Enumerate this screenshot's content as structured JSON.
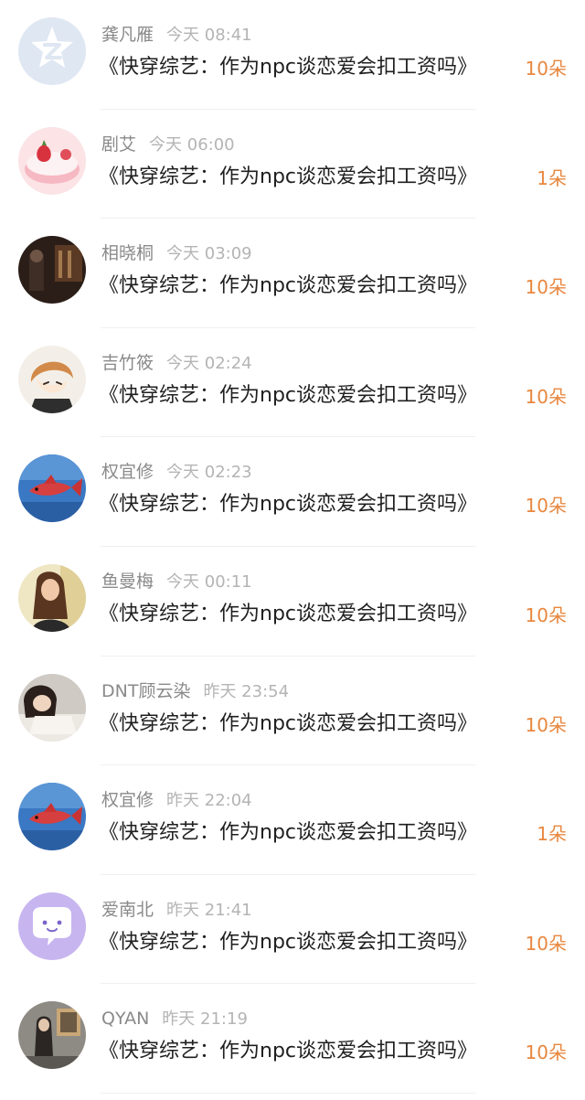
{
  "colors": {
    "name": "#8a8a8a",
    "time": "#b4b4b4",
    "title": "#1f1f1f",
    "flower_count": "#e8873f"
  },
  "items": [
    {
      "name": "龚凡雁",
      "time": "今天 08:41",
      "title": "《快穿综艺：作为npc谈恋爱会扣工资吗》",
      "count": "10朵",
      "avatar": "default-z-icon"
    },
    {
      "name": "剧艾",
      "time": "今天 06:00",
      "title": "《快穿综艺：作为npc谈恋爱会扣工资吗》",
      "count": "1朵",
      "avatar": "strawberry-cake-photo"
    },
    {
      "name": "相晓桐",
      "time": "今天 03:09",
      "title": "《快穿综艺：作为npc谈恋爱会扣工资吗》",
      "count": "10朵",
      "avatar": "dark-room-photo"
    },
    {
      "name": "吉竹筱",
      "time": "今天 02:24",
      "title": "《快穿综艺：作为npc谈恋爱会扣工资吗》",
      "count": "10朵",
      "avatar": "anime-character-illustration"
    },
    {
      "name": "权宜修",
      "time": "今天 02:23",
      "title": "《快穿综艺：作为npc谈恋爱会扣工资吗》",
      "count": "10朵",
      "avatar": "red-fish-photo"
    },
    {
      "name": "鱼曼梅",
      "time": "今天 00:11",
      "title": "《快穿综艺：作为npc谈恋爱会扣工资吗》",
      "count": "10朵",
      "avatar": "girl-portrait-photo"
    },
    {
      "name": "DNT顾云染",
      "time": "昨天 23:54",
      "title": "《快穿综艺：作为npc谈恋爱会扣工资吗》",
      "count": "10朵",
      "avatar": "girl-sleeping-photo"
    },
    {
      "name": "权宜修",
      "time": "昨天 22:04",
      "title": "《快穿综艺：作为npc谈恋爱会扣工资吗》",
      "count": "1朵",
      "avatar": "red-fish-photo"
    },
    {
      "name": "爱南北",
      "time": "昨天 21:41",
      "title": "《快穿综艺：作为npc谈恋爱会扣工资吗》",
      "count": "10朵",
      "avatar": "chat-bubble-icon"
    },
    {
      "name": "QYAN",
      "time": "昨天 21:19",
      "title": "《快穿综艺：作为npc谈恋爱会扣工资吗》",
      "count": "10朵",
      "avatar": "figure-in-room-photo"
    }
  ]
}
